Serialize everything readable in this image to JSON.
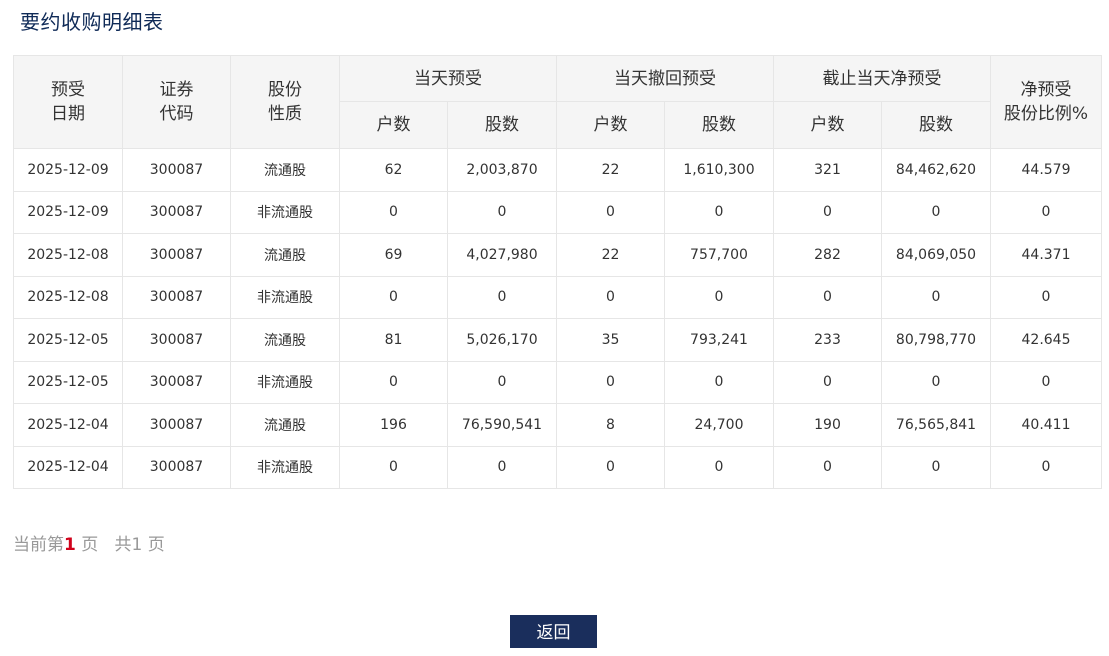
{
  "page": {
    "title": "要约收购明细表"
  },
  "table": {
    "headers": {
      "date": "预受\n日期",
      "code": "证券\n代码",
      "nature": "股份\n性质",
      "group_today": "当天预受",
      "group_withdraw": "当天撤回预受",
      "group_net": "截止当天净预受",
      "ratio": "净预受\n股份比例%",
      "households": "户数",
      "shares": "股数"
    },
    "rows": [
      [
        "2025-12-09",
        "300087",
        "流通股",
        "62",
        "2,003,870",
        "22",
        "1,610,300",
        "321",
        "84,462,620",
        "44.579"
      ],
      [
        "2025-12-09",
        "300087",
        "非流通股",
        "0",
        "0",
        "0",
        "0",
        "0",
        "0",
        "0"
      ],
      [
        "2025-12-08",
        "300087",
        "流通股",
        "69",
        "4,027,980",
        "22",
        "757,700",
        "282",
        "84,069,050",
        "44.371"
      ],
      [
        "2025-12-08",
        "300087",
        "非流通股",
        "0",
        "0",
        "0",
        "0",
        "0",
        "0",
        "0"
      ],
      [
        "2025-12-05",
        "300087",
        "流通股",
        "81",
        "5,026,170",
        "35",
        "793,241",
        "233",
        "80,798,770",
        "42.645"
      ],
      [
        "2025-12-05",
        "300087",
        "非流通股",
        "0",
        "0",
        "0",
        "0",
        "0",
        "0",
        "0"
      ],
      [
        "2025-12-04",
        "300087",
        "流通股",
        "196",
        "76,590,541",
        "8",
        "24,700",
        "190",
        "76,565,841",
        "40.411"
      ],
      [
        "2025-12-04",
        "300087",
        "非流通股",
        "0",
        "0",
        "0",
        "0",
        "0",
        "0",
        "0"
      ]
    ]
  },
  "pager": {
    "prefix": "当前第",
    "current": "1",
    "page_word": " 页",
    "total_prefix": "共",
    "total": "1",
    "total_suffix": " 页"
  },
  "actions": {
    "back_label": "返回"
  },
  "colors": {
    "title": "#0f2a57",
    "header_bg": "#f5f5f5",
    "border": "#e6e6e6",
    "pager_current": "#d0021b",
    "button_bg": "#1a2e5c"
  }
}
